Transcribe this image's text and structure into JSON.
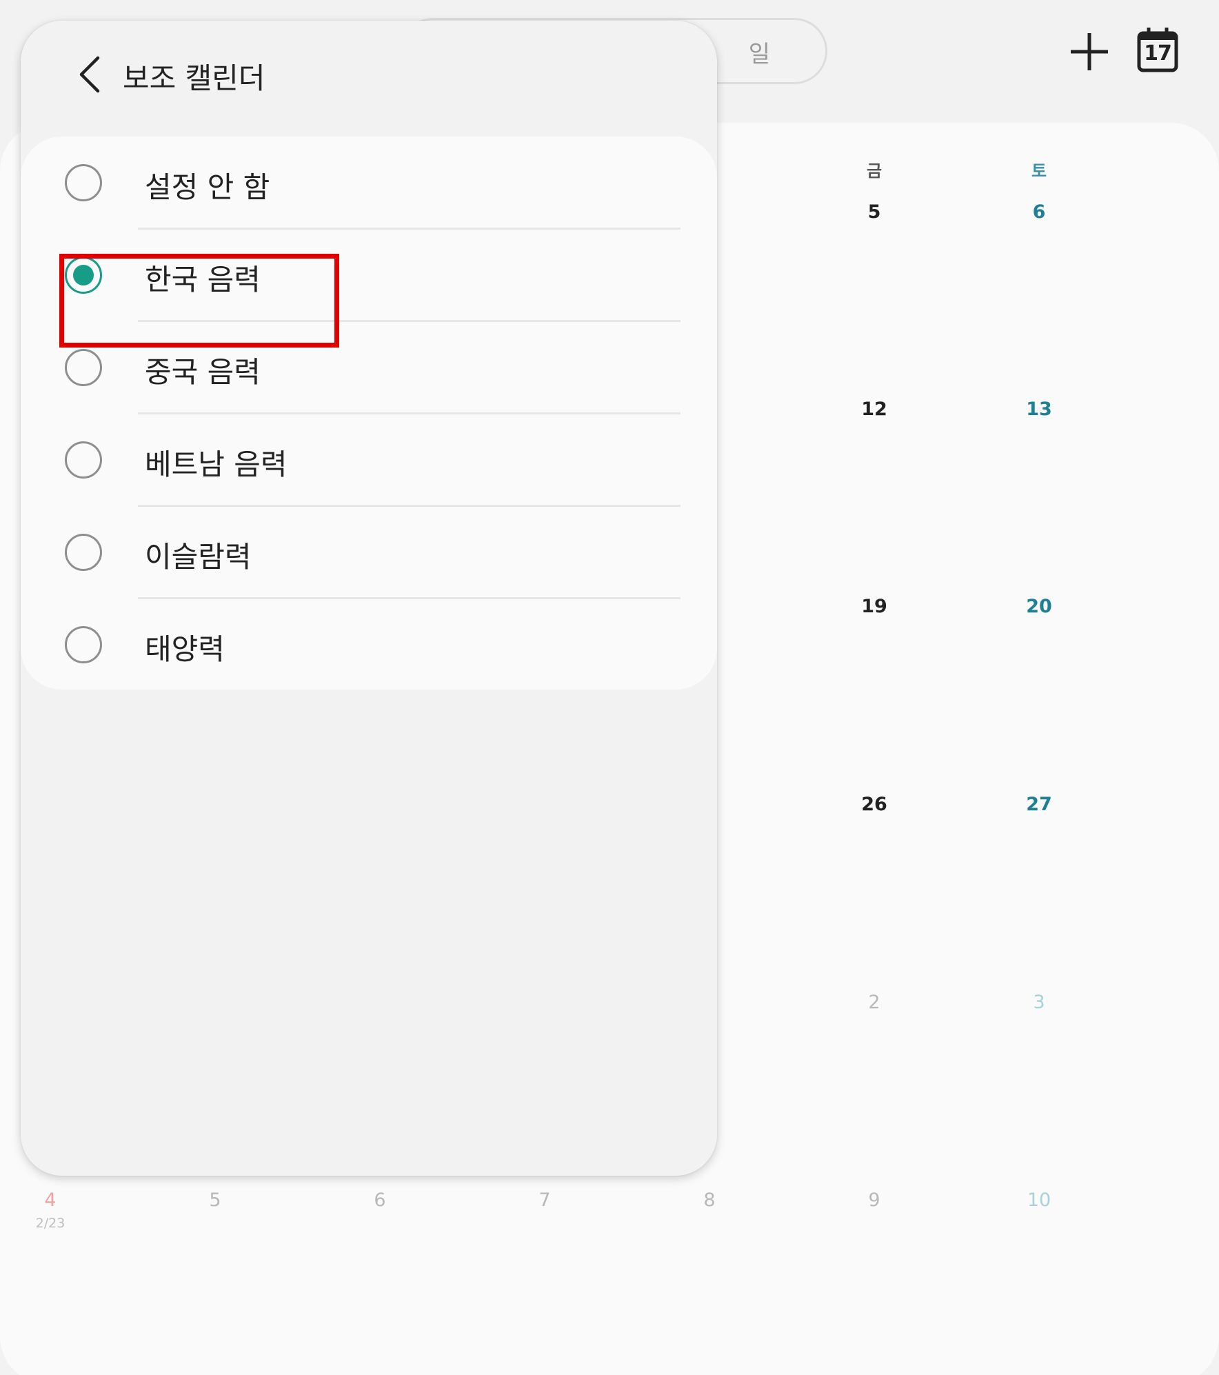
{
  "calendar": {
    "view_tab": "일",
    "today_number": "17",
    "weekday_fri": "금",
    "weekday_sat": "토",
    "fri_dates": [
      "5",
      "12",
      "19",
      "26",
      "2",
      "9"
    ],
    "sat_dates": [
      "6",
      "13",
      "20",
      "27",
      "3",
      "10"
    ],
    "bottom_row": [
      "4",
      "5",
      "6",
      "7",
      "8"
    ],
    "lunar_note": "2/23"
  },
  "sheet": {
    "title": "보조 캘린더",
    "selected_option": "한국 음력",
    "options": [
      {
        "label": "설정 안 함"
      },
      {
        "label": "한국 음력"
      },
      {
        "label": "중국 음력"
      },
      {
        "label": "베트남 음력"
      },
      {
        "label": "이슬람력"
      },
      {
        "label": "태양력"
      }
    ]
  },
  "colors": {
    "accent": "#169c87",
    "highlight": "#e00000",
    "saturday": "#1e7f95"
  }
}
